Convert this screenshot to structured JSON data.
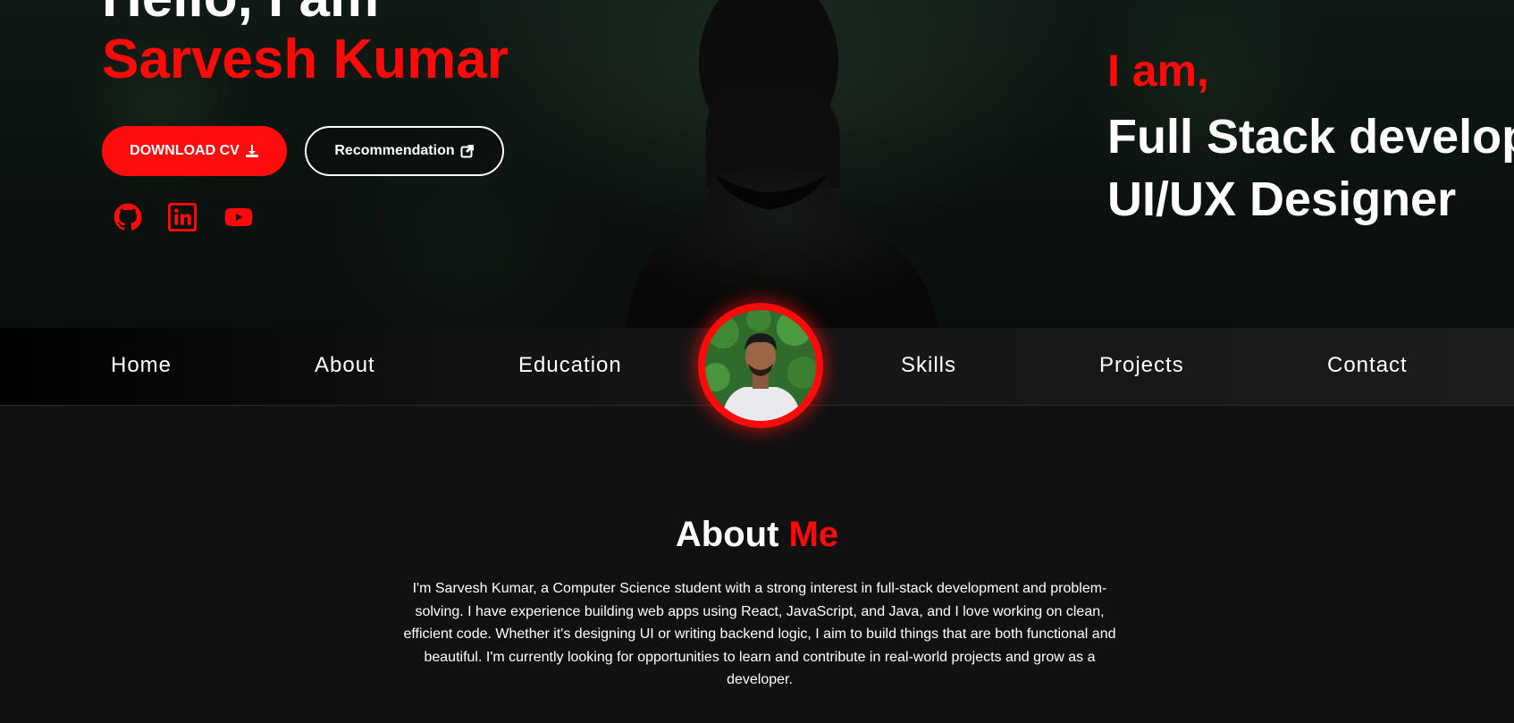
{
  "hero": {
    "greeting": "Hello, I am",
    "name": "Sarvesh Kumar",
    "download_cv_label": "DOWNLOAD CV",
    "recommendation_label": "Recommendation",
    "social": [
      {
        "icon": "github-icon"
      },
      {
        "icon": "linkedin-icon"
      },
      {
        "icon": "youtube-icon"
      }
    ],
    "i_am": "I am,",
    "roles": [
      "Full Stack developer",
      "UI/UX Designer"
    ]
  },
  "nav": {
    "items": [
      "Home",
      "About",
      "Education",
      "Skills",
      "Projects",
      "Contact"
    ]
  },
  "about": {
    "title_main": "About",
    "title_accent": "Me",
    "text": "I'm Sarvesh Kumar, a Computer Science student with a strong interest in full-stack development and problem-solving. I have experience building web apps using React, JavaScript, and Java, and I love working on clean, efficient code. Whether it's designing UI or writing backend logic, I aim to build things that are both functional and beautiful. I'm currently looking for opportunities to learn and contribute in real-world projects and grow as a developer."
  },
  "colors": {
    "accent": "#ff0a0a",
    "background": "#111111",
    "text": "#ffffff"
  }
}
